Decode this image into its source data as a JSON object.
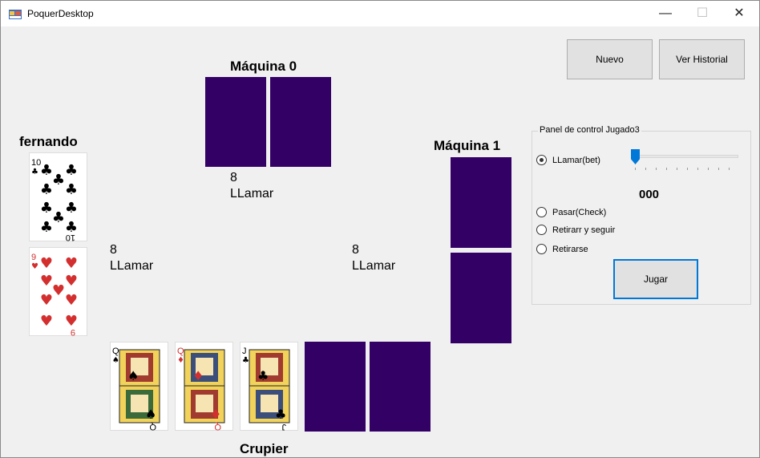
{
  "window": {
    "title": "PoquerDesktop",
    "controls": {
      "minimize": "—",
      "maximize": "☐",
      "close": "✕"
    }
  },
  "toolbar": {
    "new_label": "Nuevo",
    "history_label": "Ver Historial"
  },
  "players": {
    "machine0": {
      "name": "Máquina 0",
      "bet": "8",
      "action": "LLamar"
    },
    "machine1": {
      "name": "Máquina 1",
      "bet": "8",
      "action": "LLamar"
    },
    "human": {
      "name": "fernando",
      "bet": "8",
      "action": "LLamar",
      "cards": [
        {
          "rank": "10",
          "suit": "clubs",
          "symbol": "♣",
          "color": "#000000"
        },
        {
          "rank": "9",
          "suit": "hearts",
          "symbol": "♥",
          "color": "#d32f2f"
        }
      ]
    },
    "dealer": {
      "name": "Crupier"
    }
  },
  "community_cards": [
    {
      "rank": "Q",
      "suit": "spades",
      "symbol": "♠",
      "color": "#000000"
    },
    {
      "rank": "Q",
      "suit": "diamonds",
      "symbol": "♦",
      "color": "#d32f2f"
    },
    {
      "rank": "J",
      "suit": "clubs",
      "symbol": "♣",
      "color": "#000000"
    }
  ],
  "control_panel": {
    "title": "Panel de control Jugado3",
    "options": [
      {
        "label": "LLamar(bet)",
        "checked": true
      },
      {
        "label": "Pasar(Check)",
        "checked": false
      },
      {
        "label": "Retirarr y seguir",
        "checked": false
      },
      {
        "label": "Retirarse",
        "checked": false
      }
    ],
    "slider_value": 0,
    "bet_amount": "000",
    "play_label": "Jugar"
  },
  "colors": {
    "card_back": "#330066",
    "accent": "#0078d7",
    "window_bg": "#f0f0f0"
  }
}
